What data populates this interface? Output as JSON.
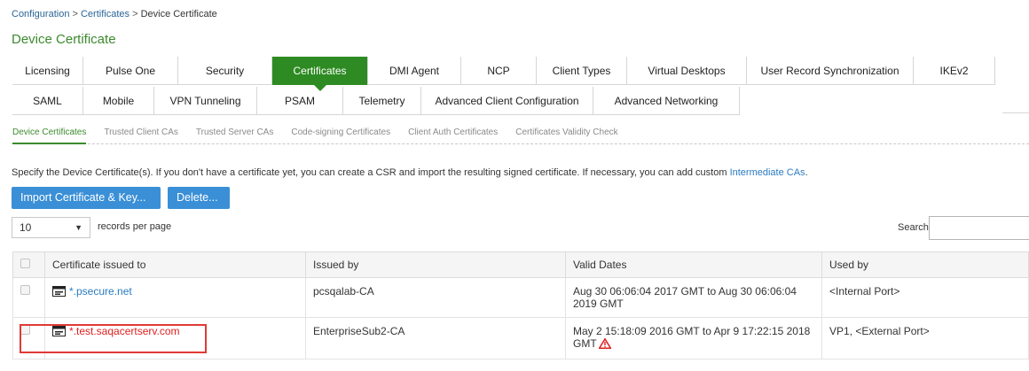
{
  "breadcrumb": {
    "item1": "Configuration",
    "sep1": " > ",
    "item2": "Certificates",
    "sep2": " > ",
    "current": "Device Certificate"
  },
  "page_title": "Device Certificate",
  "tabs_row1": [
    "Licensing",
    "Pulse One",
    "Security",
    "Certificates",
    "DMI Agent",
    "NCP",
    "Client Types",
    "Virtual Desktops",
    "User Record Synchronization",
    "IKEv2"
  ],
  "tabs_row2": [
    "SAML",
    "Mobile",
    "VPN Tunneling",
    "PSAM",
    "Telemetry",
    "Advanced Client Configuration",
    "Advanced Networking"
  ],
  "active_tab": "Certificates",
  "subtabs": [
    "Device Certificates",
    "Trusted Client CAs",
    "Trusted Server CAs",
    "Code-signing Certificates",
    "Client Auth Certificates",
    "Certificates Validity Check"
  ],
  "active_subtab": "Device Certificates",
  "description": {
    "text": "Specify the Device Certificate(s). If you don't have a certificate yet, you can create a CSR and import the resulting signed certificate. If necessary, you can add custom ",
    "link": "Intermediate CAs",
    "end": "."
  },
  "buttons": {
    "import": "Import Certificate & Key...",
    "delete": "Delete..."
  },
  "paging": {
    "value": "10",
    "label": "records per page"
  },
  "search": {
    "label": "Search:",
    "value": ""
  },
  "table": {
    "headers": [
      "Certificate issued to",
      "Issued by",
      "Valid Dates",
      "Used by"
    ],
    "rows": [
      {
        "issued_to": "*.psecure.net",
        "issued_by": "pcsqalab-CA",
        "valid_line1": "Aug 30 06:06:04 2017 GMT to Aug 30 06:06:04",
        "valid_line2": "2019 GMT",
        "used_by": "<Internal Port>",
        "expired": false
      },
      {
        "issued_to": "*.test.saqacertserv.com",
        "issued_by": "EnterpriseSub2-CA",
        "valid_line1": "May 2 15:18:09 2016 GMT to Apr 9 17:22:15 2018",
        "valid_line2": "GMT",
        "used_by": "VP1, <External Port>",
        "expired": true
      }
    ]
  },
  "colors": {
    "accent_green": "#2e8b23",
    "button_blue": "#3a8fd6",
    "link_blue": "#2a7bc0",
    "error_red": "#e0201f",
    "highlight": "#e03a35"
  },
  "icons": {
    "certificate": "certificate-icon",
    "warning": "warning-icon",
    "dropdown": "chevron-down-icon"
  }
}
